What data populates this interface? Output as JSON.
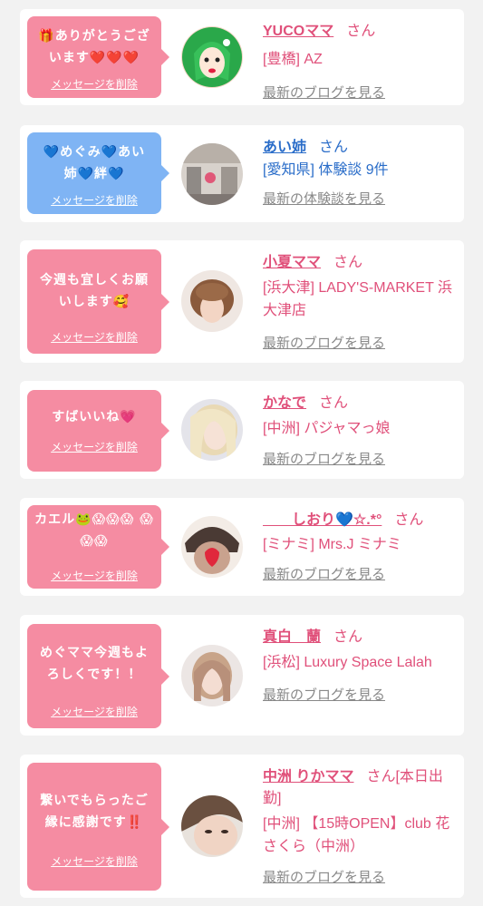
{
  "items": [
    {
      "message": "🎁ありがとうござ います❤️❤️❤️",
      "delete_label": "メッセージを削除",
      "name": "YUCOママ",
      "honorific": "さん",
      "location": "[豊橋] AZ",
      "link": "最新のブログを見る"
    },
    {
      "message": "💙めぐみ💙あい 姉💙絆💙",
      "delete_label": "メッセージを削除",
      "name": "あい姉",
      "honorific": "さん",
      "location": "[愛知県] 体験談 9件",
      "link": "最新の体験談を見る"
    },
    {
      "message": "今週も宜しくお願 いします🥰",
      "delete_label": "メッセージを削除",
      "name": "小夏ママ",
      "honorific": "さん",
      "location": "[浜大津] LADY'S-MARKET 浜大津店",
      "link": "最新のブログを見る"
    },
    {
      "message": "すばいいね💗",
      "delete_label": "メッセージを削除",
      "name": "かなで",
      "honorific": "さん",
      "location": "[中洲] パジャマっ娘",
      "link": "最新のブログを見る"
    },
    {
      "message": "カエル🐸😱😱😱 😱😱😱",
      "delete_label": "メッセージを削除",
      "name": "　　しおり💙☆.*°",
      "honorific": "さん",
      "location": "[ミナミ] Mrs.J ミナミ",
      "link": "最新のブログを見る"
    },
    {
      "message": "めぐママ今週もよ ろしくです！！",
      "delete_label": "メッセージを削除",
      "name": "真白　蘭",
      "honorific": "さん",
      "location": "[浜松] Luxury Space Lalah",
      "link": "最新のブログを見る"
    },
    {
      "message": "繋いでもらったご 縁に感謝です‼️",
      "delete_label": "メッセージを削除",
      "name": "中洲 りかママ",
      "honorific": "さん[本日出勤]",
      "location": "[中洲] 【15時OPEN】club 花さくら（中洲）",
      "link": "最新のブログを見る"
    }
  ]
}
